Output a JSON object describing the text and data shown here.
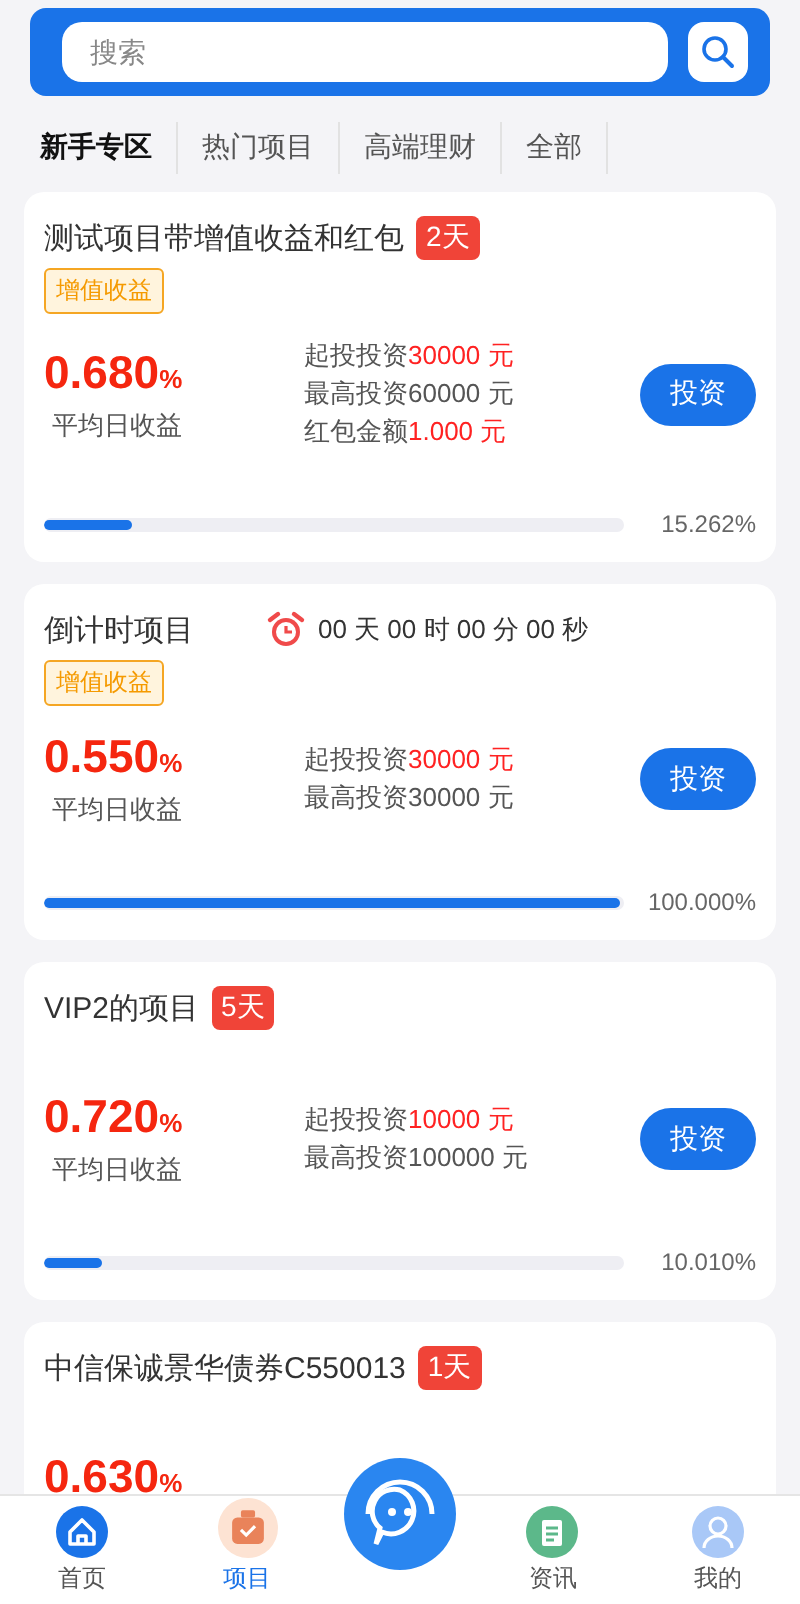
{
  "search": {
    "placeholder": "搜索"
  },
  "tabs": [
    {
      "label": "新手专区",
      "selected": true
    },
    {
      "label": "热门项目",
      "selected": false
    },
    {
      "label": "高端理财",
      "selected": false
    },
    {
      "label": "全部",
      "selected": false
    }
  ],
  "projects": [
    {
      "title": "测试项目带增值收益和红包",
      "days_badge": "2天",
      "tag": "增值收益",
      "rate": "0.680",
      "rate_unit": "%",
      "rate_label": "平均日收益",
      "details": [
        {
          "label": "起投投资",
          "value": "30000 元",
          "highlight": true
        },
        {
          "label": "最高投资",
          "value": "60000 元",
          "highlight": false
        },
        {
          "label": "红包金额",
          "value": "1.000 元",
          "highlight": true
        }
      ],
      "button": "投资",
      "progress": {
        "level": 0.15262,
        "reading": "15.262%"
      }
    },
    {
      "title": "倒计时项目",
      "countdown": "00 天 00 时 00 分 00 秒",
      "tag": "增值收益",
      "rate": "0.550",
      "rate_unit": "%",
      "rate_label": "平均日收益",
      "details": [
        {
          "label": "起投投资",
          "value": "30000 元",
          "highlight": true
        },
        {
          "label": "最高投资",
          "value": "30000 元",
          "highlight": false
        }
      ],
      "button": "投资",
      "progress": {
        "level": 1,
        "reading": "100.000%"
      }
    },
    {
      "title": "VIP2的项目",
      "days_badge": "5天",
      "rate": "0.720",
      "rate_unit": "%",
      "rate_label": "平均日收益",
      "details": [
        {
          "label": "起投投资",
          "value": "10000 元",
          "highlight": true
        },
        {
          "label": "最高投资",
          "value": "100000 元",
          "highlight": false
        }
      ],
      "button": "投资",
      "progress": {
        "level": 0.1001,
        "reading": "10.010%"
      }
    },
    {
      "title": "中信保诚景华债券C550013",
      "days_badge": "1天",
      "rate": "0.630",
      "rate_unit": "%"
    }
  ],
  "nav": [
    {
      "kind": "home",
      "label": "首页",
      "selected": false
    },
    {
      "kind": "project",
      "label": "项目",
      "selected": true
    },
    {
      "kind": "service"
    },
    {
      "kind": "news",
      "label": "资讯",
      "selected": false
    },
    {
      "kind": "user",
      "label": "我的",
      "selected": false
    }
  ]
}
